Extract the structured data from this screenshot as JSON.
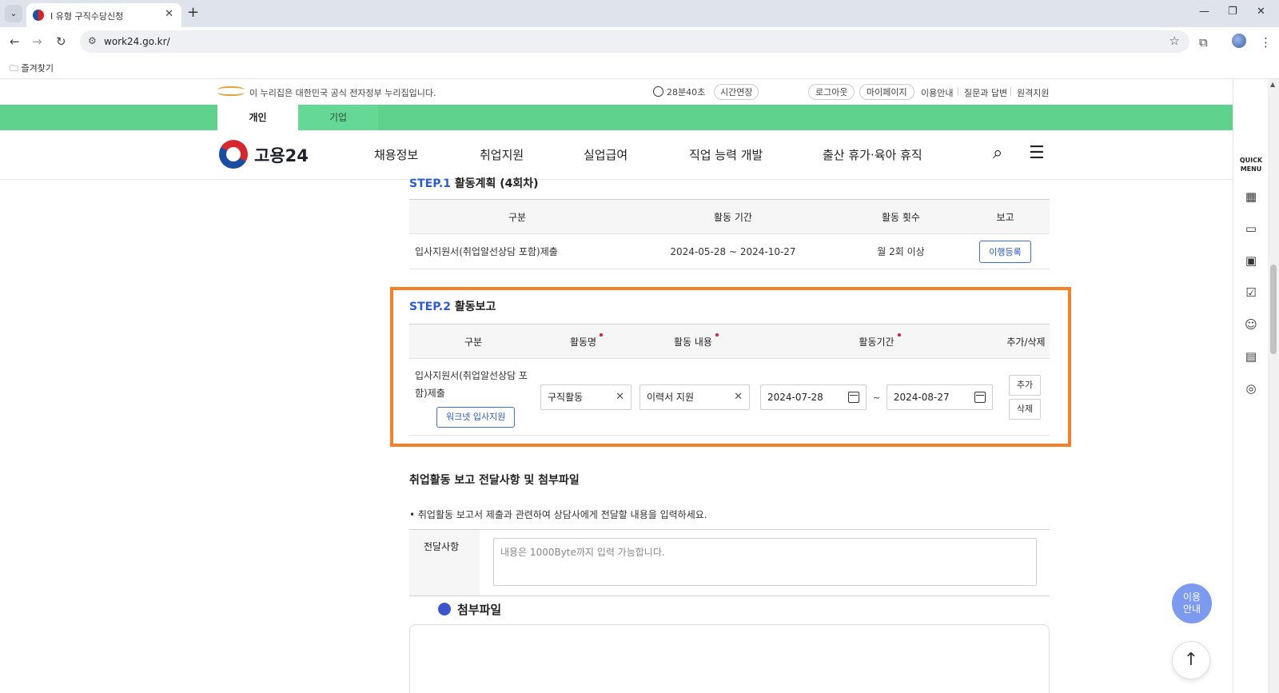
{
  "browser": {
    "tab_title": "I 유형 구직수당신청",
    "url": "work24.go.kr/",
    "bookmark_folder": "즐겨찾기"
  },
  "gov_bar": {
    "notice": "이 누리집은 대한민국 공식 전자정부 누리집입니다.",
    "timer": "28분40초",
    "extend": "시간연장",
    "logout": "로그아웃",
    "mypage": "마이페이지",
    "links": [
      "이용안내",
      "질문과 답변",
      "원격지원"
    ]
  },
  "user_tabs": {
    "personal": "개인",
    "company": "기업"
  },
  "brand": "고용24",
  "gnb": [
    "채용정보",
    "취업지원",
    "실업급여",
    "직업 능력 개발",
    "출산 휴가·육아 휴직"
  ],
  "step1": {
    "label": "STEP.1",
    "title": "활동계획 (4회차)",
    "headers": [
      "구분",
      "활동 기간",
      "활동 횟수",
      "보고"
    ],
    "row": {
      "category": "입사지원서(취업알선상담 포함)제출",
      "period": "2024-05-28 ~ 2024-10-27",
      "count": "월 2회 이상",
      "action": "이행등록"
    }
  },
  "step2": {
    "label": "STEP.2",
    "title": "활동보고",
    "headers": [
      "구분",
      "활동명",
      "활동 내용",
      "활동기간",
      "추가/삭제"
    ],
    "row": {
      "category": "입사지원서(취업알선상담 포함)제출",
      "worknet_btn": "워크넷 입사지원",
      "activity_name": "구직활동",
      "activity_content": "이력서 지원",
      "start_date": "2024-07-28",
      "range_sep": "~",
      "end_date": "2024-08-27",
      "add": "추가",
      "delete": "삭제"
    }
  },
  "report": {
    "title": "취업활동 보고 전달사항 및 첨부파일",
    "note": "• 취업활동 보고서 제출과 관련하여 상담사에게 전달할 내용을 입력하세요.",
    "field_label": "전달사항",
    "placeholder": "내용은 1000Byte까지 입력 가능합니다."
  },
  "attachment_title": "첨부파일",
  "quick_menu": "QUICK MENU",
  "float_help": "이용 안내"
}
